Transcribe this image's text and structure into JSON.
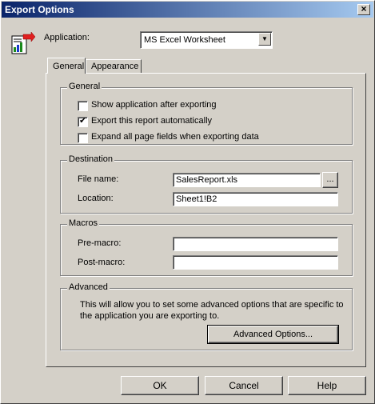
{
  "window": {
    "title": "Export Options",
    "close_glyph": "×"
  },
  "application": {
    "label": "Application:",
    "selected": "MS Excel Worksheet",
    "dropdown_glyph": "▼"
  },
  "tabs": [
    {
      "label": "General"
    },
    {
      "label": "Appearance"
    }
  ],
  "general_group": {
    "title": "General",
    "options": [
      {
        "label": "Show application after exporting",
        "checked": false
      },
      {
        "label": "Export this report automatically",
        "checked": true
      },
      {
        "label": "Expand all page fields when exporting data",
        "checked": false
      }
    ]
  },
  "destination": {
    "title": "Destination",
    "file_name_label": "File name:",
    "file_name_value": "SalesReport.xls",
    "browse_label": "...",
    "location_label": "Location:",
    "location_value": "Sheet1!B2"
  },
  "macros": {
    "title": "Macros",
    "pre_label": "Pre-macro:",
    "pre_value": "",
    "post_label": "Post-macro:",
    "post_value": ""
  },
  "advanced": {
    "title": "Advanced",
    "description": "This will allow you to set some advanced options that are specific to the application you are exporting to.",
    "button_label": "Advanced Options..."
  },
  "footer": {
    "ok_label": "OK",
    "cancel_label": "Cancel",
    "help_label": "Help"
  },
  "colors": {
    "dialog_bg": "#d4d0c8",
    "title_start": "#0a246a",
    "title_end": "#a6caf0"
  }
}
